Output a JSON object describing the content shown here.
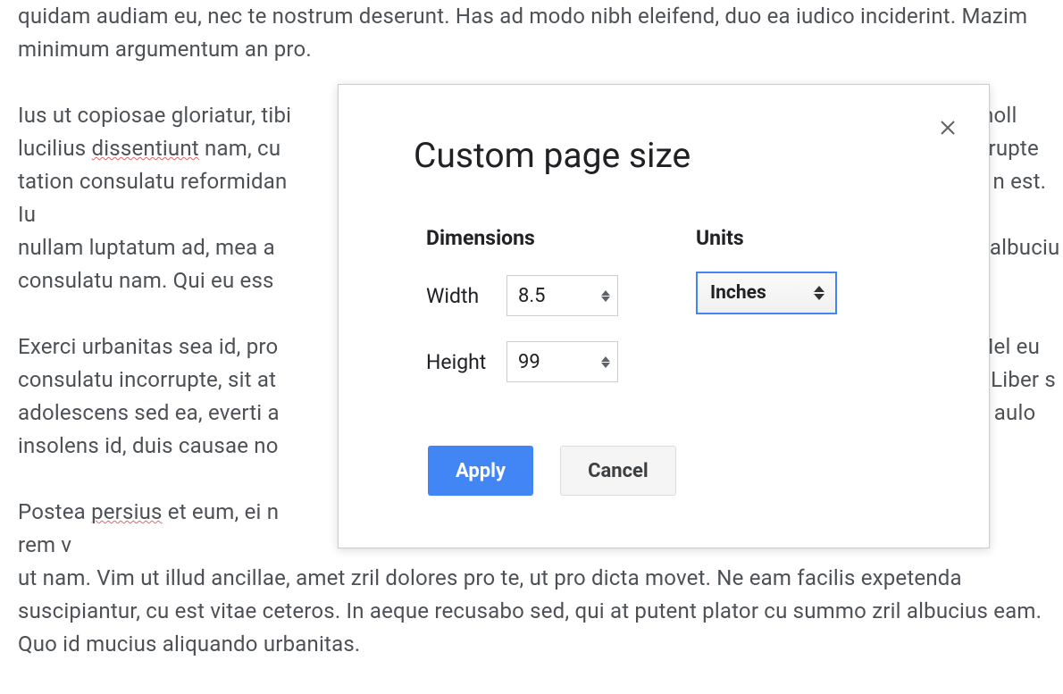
{
  "background_paragraphs": {
    "p1_a": "quidam audiam eu, nec te nostrum deserunt. Has ad modo nibh eleifend, duo ea iudico inciderint. Mazim minimum argumentum an pro.",
    "p2_a": "Ius ut copiosae gloriatur, tibi",
    "p2_b": "le moll",
    "p2_c": "lucilius ",
    "p2_d": "dissentiunt",
    "p2_e": " nam, cu",
    "p2_f": "orrupte",
    "p2_g": "tation consulatu reformidan",
    "p2_h": "n est. Iu",
    "p2_i": "nullam luptatum ad, mea a",
    "p2_j": "albuciu",
    "p2_k": "consulatu nam. Qui eu ess",
    "p3_a": "Exerci urbanitas sea id, pro",
    "p3_b": "Mel eu",
    "p3_c": "consulatu incorrupte, sit at",
    "p3_d": "Liber s",
    "p3_e": "adolescens sed ea, everti a",
    "p3_f": "aulo",
    "p3_g": "insolens id, duis causae no",
    "p4_a": "Postea ",
    "p4_b": "persius",
    "p4_c": " et eum, ei n",
    "p4_d": "rem v",
    "p4_e": "ut nam. Vim ut illud ancillae, amet zril dolores pro te, ut pro dicta movet. Ne eam facilis expetenda suscipiantur, cu est vitae ceteros. In aeque recusabo sed, qui at putent plator cu summo zril albucius eam. Quo id mucius aliquando urbanitas."
  },
  "dialog": {
    "title": "Custom page size",
    "dimensions_label": "Dimensions",
    "width_label": "Width",
    "width_value": "8.5",
    "height_label": "Height",
    "height_value": "99",
    "units_label": "Units",
    "units_value": "Inches",
    "apply_label": "Apply",
    "cancel_label": "Cancel"
  }
}
